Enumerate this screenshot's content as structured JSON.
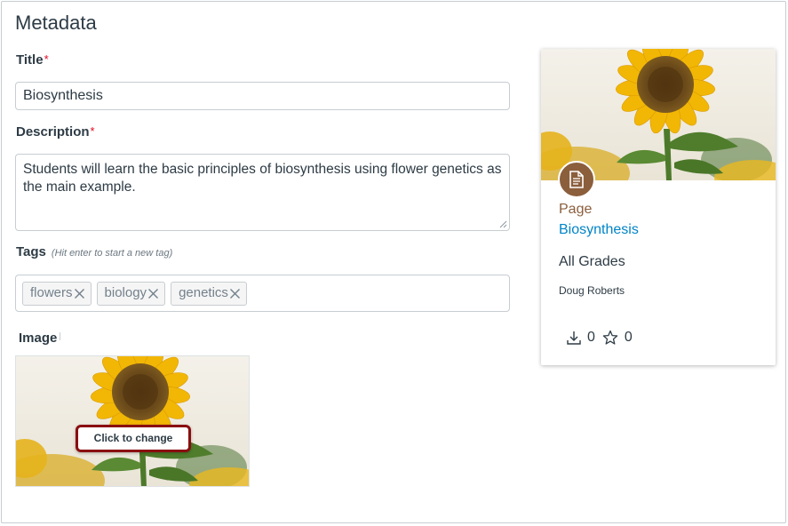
{
  "page": {
    "title": "Metadata"
  },
  "form": {
    "title": {
      "label": "Title",
      "required_mark": "*",
      "value": "Biosynthesis"
    },
    "description": {
      "label": "Description",
      "required_mark": "*",
      "value": "Students will learn the basic principles of biosynthesis using flower genetics as the main example."
    },
    "tags": {
      "label": "Tags",
      "hint": "(Hit enter to start a new tag)",
      "items": [
        {
          "label": "flowers"
        },
        {
          "label": "biology"
        },
        {
          "label": "genetics"
        }
      ]
    },
    "image": {
      "label": "Image",
      "change_button": "Click to change"
    }
  },
  "preview_card": {
    "type": "Page",
    "title": "Biosynthesis",
    "grades": "All Grades",
    "author": "Doug Roberts",
    "downloads": "0",
    "favorites": "0",
    "icon": "document-icon"
  },
  "colors": {
    "required": "#e0061f",
    "link": "#0084c7",
    "type_badge": "#8b5e3c",
    "highlight_border": "#8a0e10"
  }
}
